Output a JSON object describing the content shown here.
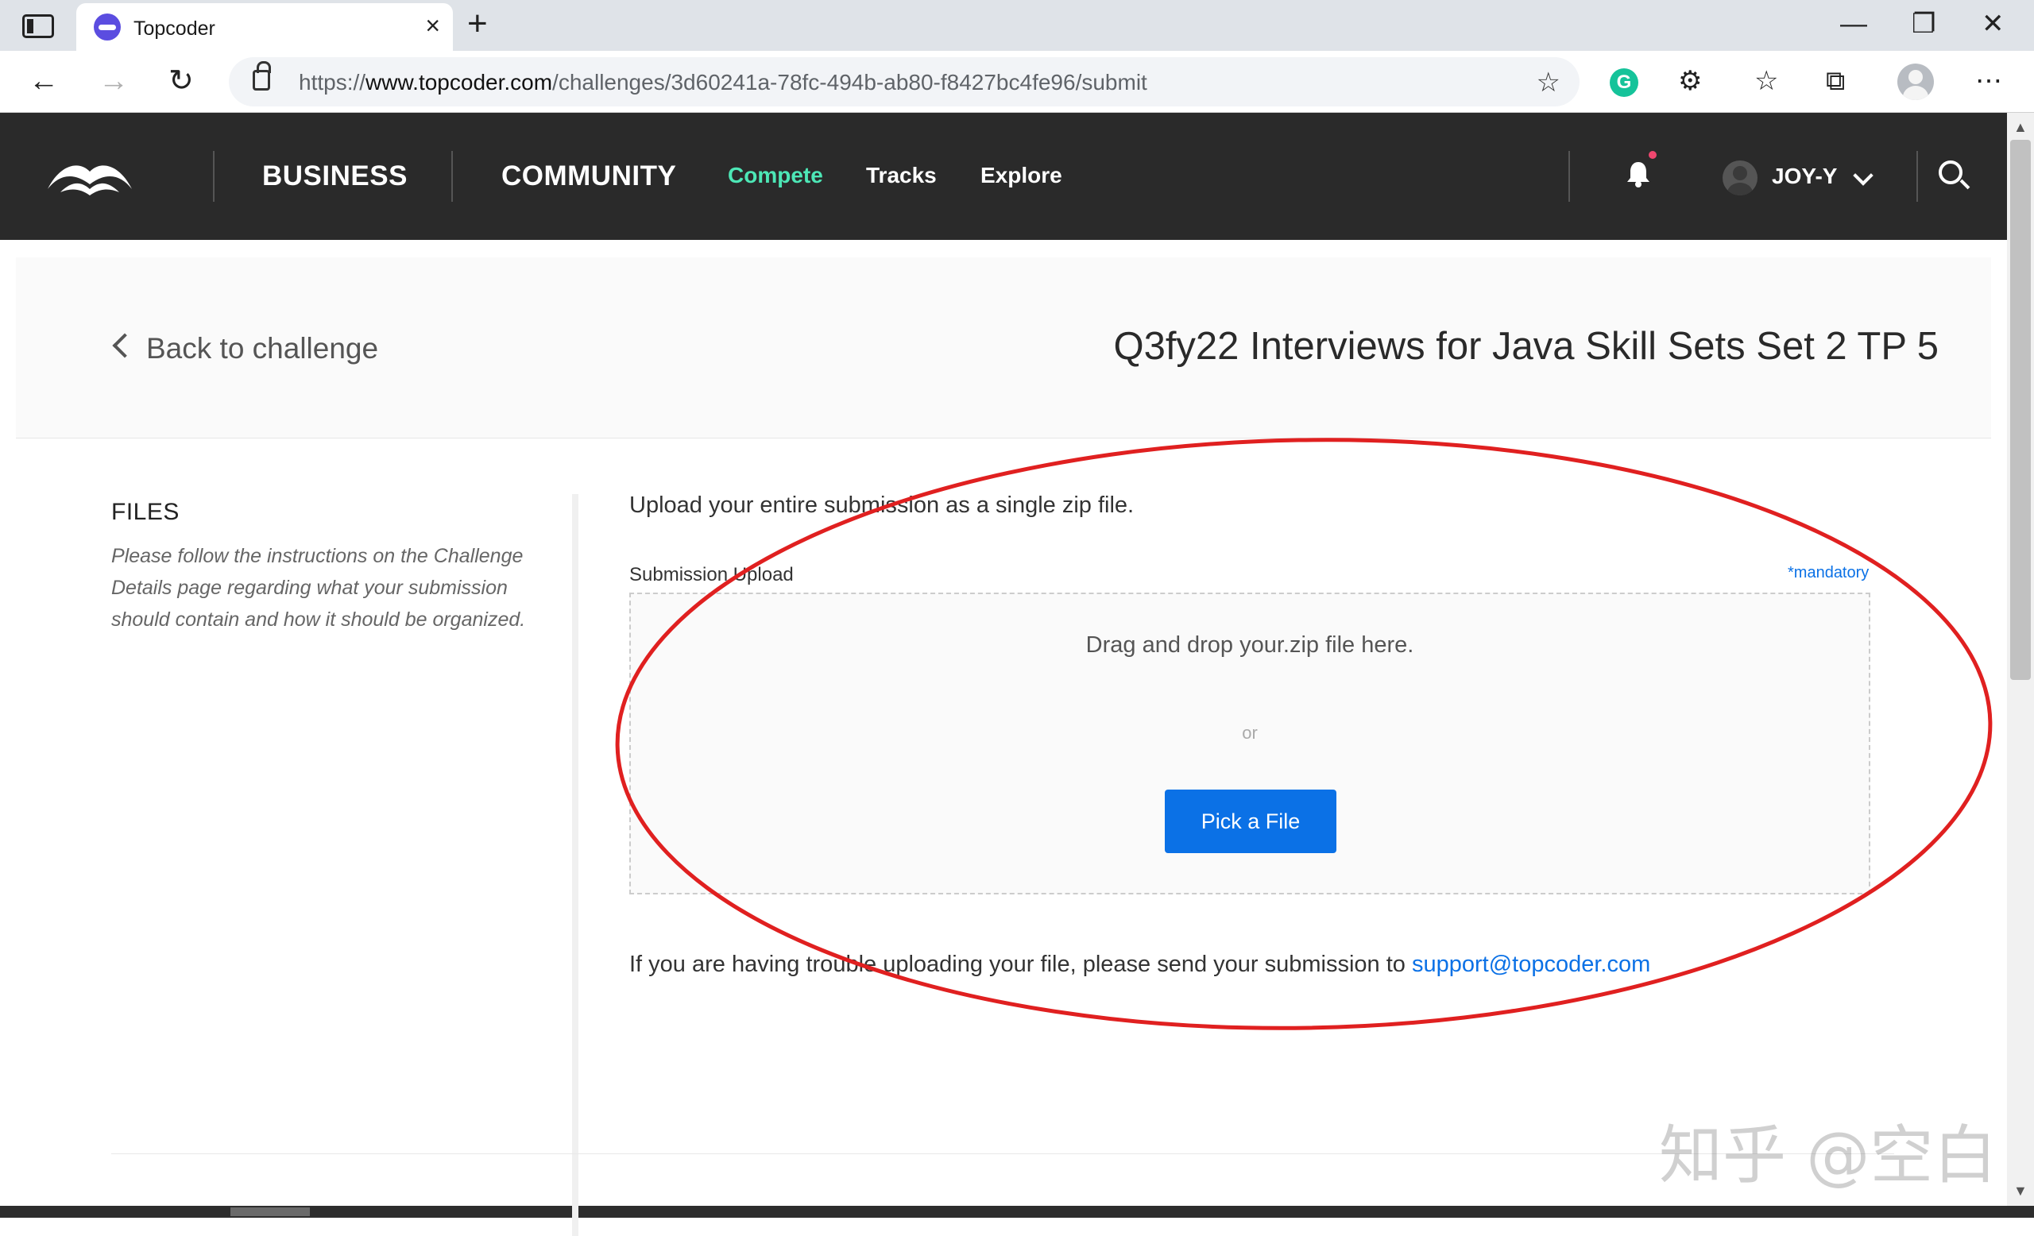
{
  "browser": {
    "tab_title": "Topcoder",
    "url_prefix": "https://",
    "url_domain": "www.topcoder.com",
    "url_path": "/challenges/3d60241a-78fc-494b-ab80-f8427bc4fe96/submit",
    "new_tab_glyph": "+",
    "close_glyph": "×"
  },
  "header": {
    "nav": [
      "BUSINESS",
      "COMMUNITY",
      "Compete",
      "Tracks",
      "Explore"
    ],
    "active_item": "Compete",
    "accent_color": "#4de7b6",
    "user": "JOY-Y"
  },
  "challenge": {
    "back_label": "Back to challenge",
    "title": "Q3fy22 Interviews for Java Skill Sets Set 2 TP 5"
  },
  "files": {
    "title": "FILES",
    "description": "Please follow the instructions on the Challenge Details page regarding what your submission should contain and how it should be organized."
  },
  "upload": {
    "intro": "Upload your entire submission as a single zip file.",
    "label": "Submission Upload",
    "mandatory": "*mandatory",
    "drop_text": "Drag and drop your.zip file here.",
    "or_text": "or",
    "button_label": "Pick a File",
    "button_color": "#0b71e6",
    "trouble_text": "If you are having trouble uploading your file, please send your submission to ",
    "support_email": "support@topcoder.com"
  },
  "watermark": "知乎 @空白",
  "annotation_color": "#e02020"
}
